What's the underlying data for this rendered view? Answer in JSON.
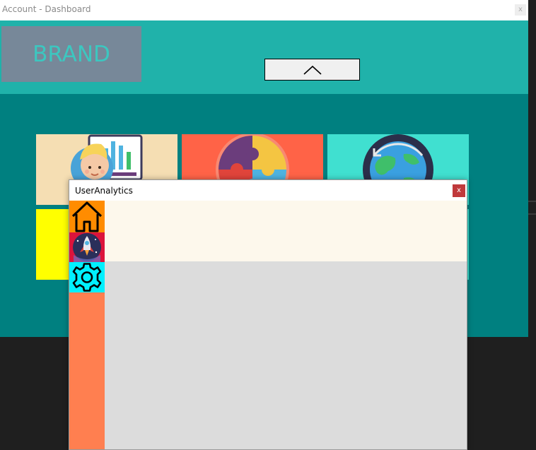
{
  "main_window": {
    "title": "Account - Dashboard",
    "close_label": "x",
    "brand": "BRAND",
    "collapse_icon": "chevron-up-icon",
    "tiles": [
      {
        "icon": "user-analytics-icon",
        "color": "#f5deb3"
      },
      {
        "icon": "puzzle-icon",
        "color": "#ff6347"
      },
      {
        "icon": "globe-refresh-icon",
        "color": "#40e0d0"
      },
      {
        "icon": "",
        "color": "#ffff00"
      },
      {
        "icon": "",
        "color": "#ff6347"
      },
      {
        "icon": "",
        "color": "#40e0d0"
      }
    ],
    "colors": {
      "background": "#008080",
      "header": "#20b2aa",
      "brand_box": "#778899",
      "brand_text": "#3cc7c0"
    }
  },
  "dialog": {
    "title": "UserAnalytics",
    "close_label": "x",
    "nav": [
      {
        "icon": "home-icon",
        "color": "#ff8c00"
      },
      {
        "icon": "rocket-icon",
        "color": "#dc143c"
      },
      {
        "icon": "gear-icon",
        "color": "#00f0ff"
      }
    ],
    "colors": {
      "sidebar": "#ff7f50",
      "header_panel": "#fdf8ec",
      "content": "#dcdcdc",
      "close": "#c0393b"
    }
  }
}
